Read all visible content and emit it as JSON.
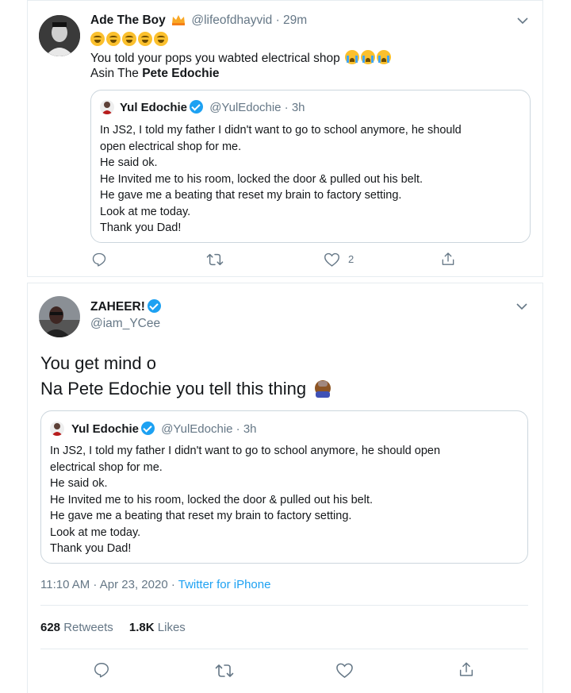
{
  "tweet1": {
    "name": "Ade The Boy",
    "handle_time": "@lifeofdhayvid · 29m",
    "text_line2": "You told your pops you wabted electrical shop",
    "text_line3_prefix": "Asin The",
    "text_line3_bold": "Pete Edochie",
    "quote": {
      "name": "Yul Edochie",
      "handle_time": "@YulEdochie · 3h",
      "lines": [
        "In JS2, I told my father I didn't want to go to school anymore, he should",
        "open electrical shop for me.",
        "He said ok.",
        "He Invited me to his room, locked the door & pulled out his belt.",
        "He gave me a beating that reset my brain to factory setting.",
        "Look at me today.",
        "Thank you Dad!"
      ]
    },
    "like_count": "2"
  },
  "tweet2": {
    "name": "ZAHEER!",
    "handle": "@iam_YCee",
    "text_line1": "You get mind o",
    "text_line2": "Na Pete Edochie you tell this thing",
    "quote": {
      "name": "Yul Edochie",
      "handle_time": "@YulEdochie · 3h",
      "lines": [
        "In JS2, I told my father I didn't want to go to school anymore, he should open",
        "electrical shop for me.",
        "He said ok.",
        "He Invited me to his room, locked the door & pulled out his belt.",
        "He gave me a beating that reset my brain to factory setting.",
        "Look at me today.",
        "Thank you Dad!"
      ]
    },
    "timestamp": "11:10 AM · Apr 23, 2020 ·",
    "source": "Twitter for iPhone",
    "retweets_count": "628",
    "retweets_label": "Retweets",
    "likes_count": "1.8K",
    "likes_label": "Likes"
  },
  "colors": {
    "link": "#1da1f2",
    "muted": "#657786",
    "text": "#14171a",
    "border": "#e6ecf0"
  },
  "icons": [
    "chevron-down-icon",
    "reply-icon",
    "retweet-icon",
    "like-icon",
    "share-icon",
    "verified-icon",
    "crown-icon"
  ]
}
